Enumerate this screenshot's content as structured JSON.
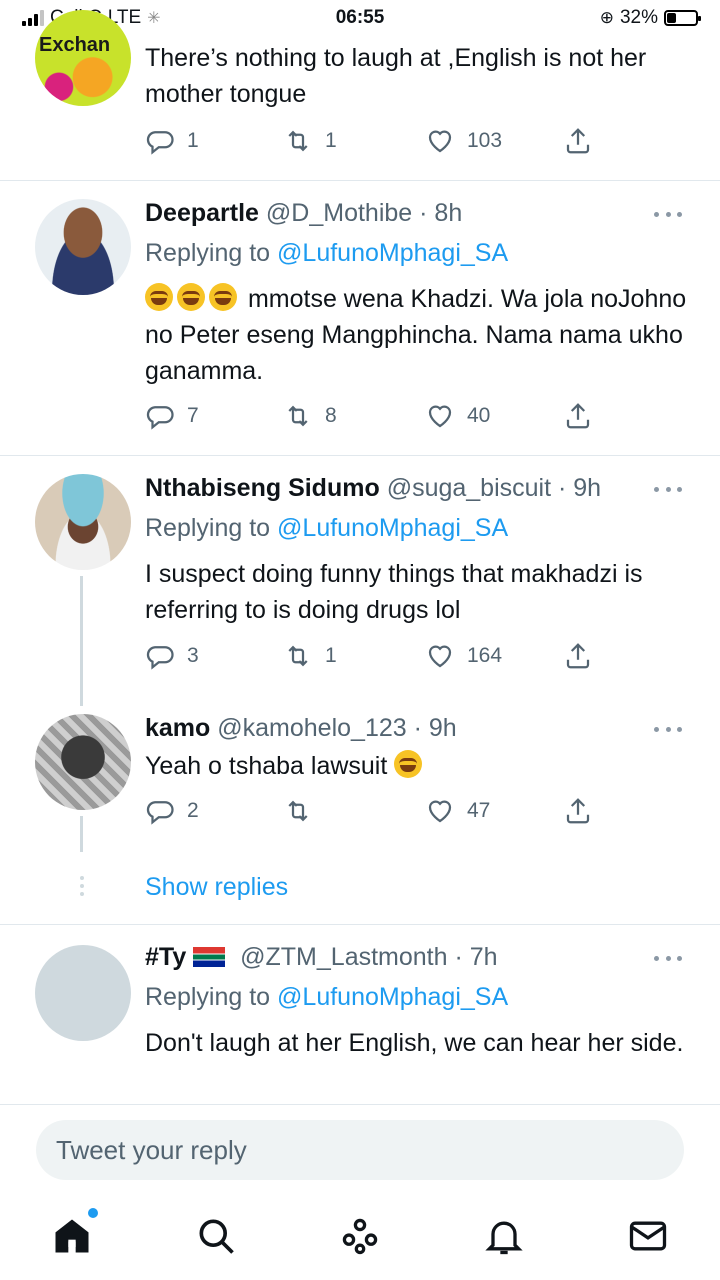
{
  "status_bar": {
    "carrier": "Cell C",
    "network": "LTE",
    "time": "06:55",
    "battery_percent": "32%",
    "battery_level": 0.32
  },
  "tweets": [
    {
      "text_lines": "There’s nothing to laugh at ,English is not her mother tongue",
      "avatar_text": "Exchan",
      "replies": "1",
      "retweets": "1",
      "likes": "103"
    },
    {
      "name": "Deepartle",
      "handle": "@D_Mothibe",
      "time": "· 8h",
      "replying_prefix": "Replying to ",
      "replying_to": "@LufunoMphagi_SA",
      "text": "mmotse wena Khadzi. Wa jola noJohno no Peter eseng Mangphincha. Nama nama ukho ganamma.",
      "replies": "7",
      "retweets": "8",
      "likes": "40"
    },
    {
      "name": "Nthabiseng Sidumo",
      "handle": "@suga_biscuit",
      "time": "· 9h",
      "replying_prefix": "Replying to ",
      "replying_to": "@LufunoMphagi_SA",
      "text": "I suspect doing funny things that makhadzi is referring to is doing drugs lol",
      "replies": "3",
      "retweets": "1",
      "likes": "164"
    },
    {
      "name": "kamo",
      "handle": "@kamohelo_123",
      "time": "· 9h",
      "text": "Yeah o tshaba lawsuit",
      "replies": "2",
      "retweets": "",
      "likes": "47"
    },
    {
      "name": "#Ty",
      "handle": "@ZTM_Lastmonth",
      "time": "· 7h",
      "replying_prefix": "Replying to ",
      "replying_to": "@LufunoMphagi_SA",
      "text": "Don't laugh at her English, we can hear her side."
    }
  ],
  "show_replies": "Show replies",
  "reply_placeholder": "Tweet your reply",
  "colors": {
    "accent": "#1d9bf0",
    "secondary_text": "#536471",
    "divider": "#e1e8ed"
  },
  "nav": [
    "home-icon",
    "search-icon",
    "spaces-icon",
    "notifications-icon",
    "messages-icon"
  ]
}
